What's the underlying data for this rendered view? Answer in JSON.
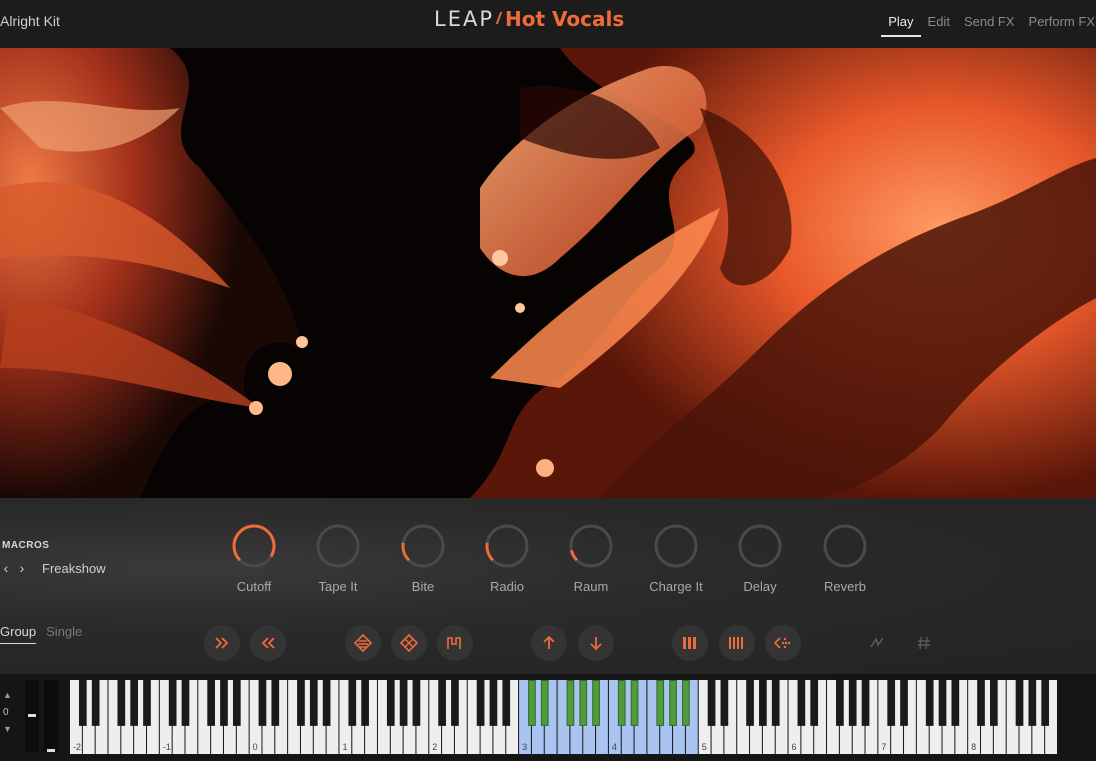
{
  "header": {
    "kit_name": "Alright Kit",
    "brand": "LEAP",
    "product": "Hot Vocals",
    "tabs": [
      {
        "label": "Play",
        "active": true
      },
      {
        "label": "Edit",
        "active": false
      },
      {
        "label": "Send FX",
        "active": false
      },
      {
        "label": "Perform FX",
        "active": false
      }
    ]
  },
  "macros": {
    "title": "MACROS",
    "preset": "Freakshow",
    "knobs": [
      {
        "label": "Cutoff",
        "value": 0.95
      },
      {
        "label": "Tape It",
        "value": 0.0
      },
      {
        "label": "Bite",
        "value": 0.2
      },
      {
        "label": "Radio",
        "value": 0.2
      },
      {
        "label": "Raum",
        "value": 0.12
      },
      {
        "label": "Charge It",
        "value": 0.0
      },
      {
        "label": "Delay",
        "value": 0.0
      },
      {
        "label": "Reverb",
        "value": 0.0
      }
    ]
  },
  "mode_tabs": [
    {
      "label": "Group",
      "active": true
    },
    {
      "label": "Single",
      "active": false
    }
  ],
  "transport_buttons": [
    {
      "icon": "double-chevron-right-icon"
    },
    {
      "icon": "double-chevron-left-icon"
    },
    {
      "icon": "stack-diamond-icon"
    },
    {
      "icon": "stack-diamond-hatched-icon"
    },
    {
      "icon": "envelope-shape-icon"
    },
    {
      "icon": "arrow-up-icon"
    },
    {
      "icon": "arrow-down-icon"
    },
    {
      "icon": "slice-bars-icon"
    },
    {
      "icon": "slice-bars-dense-icon"
    },
    {
      "icon": "reverse-dots-icon"
    },
    {
      "icon": "dimmed-effect-icon"
    },
    {
      "icon": "dimmed-hash-icon"
    }
  ],
  "keyboard": {
    "octave_shift": "0",
    "octave_labels": [
      "-2",
      "-1",
      "0",
      "1",
      "2",
      "3",
      "4",
      "5",
      "6",
      "7",
      "8"
    ],
    "active_range_octaves": [
      3,
      5
    ],
    "accent_color": "#ef6b3a",
    "highlight_color": "#a9c4f0"
  }
}
